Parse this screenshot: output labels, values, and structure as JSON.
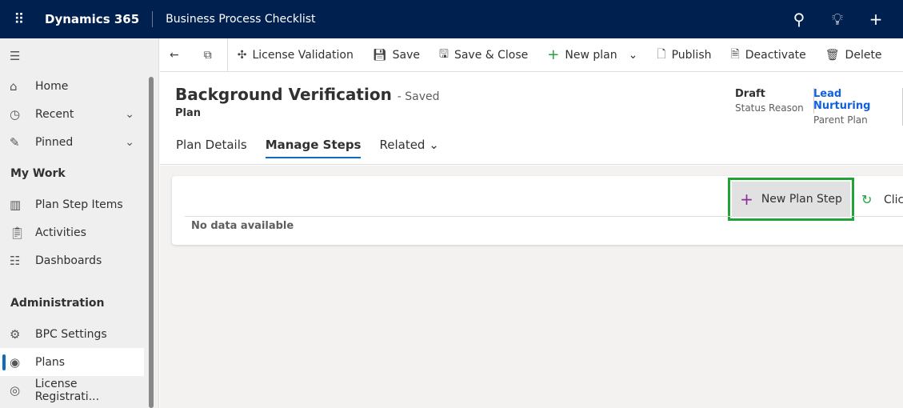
{
  "topbar": {
    "brand": "Dynamics 365",
    "app": "Business Process Checklist",
    "icons": [
      "waffle-icon",
      "search-icon",
      "lightbulb-icon",
      "plus-icon"
    ]
  },
  "sidebar": {
    "items": [
      {
        "label": "Home",
        "icon": "home-icon"
      },
      {
        "label": "Recent",
        "icon": "clock-icon"
      },
      {
        "label": "Pinned",
        "icon": "pin-icon"
      }
    ],
    "my_work": {
      "label": "My Work",
      "items": [
        {
          "label": "Plan Step Items"
        },
        {
          "label": "Activities"
        },
        {
          "label": "Dashboards"
        }
      ]
    },
    "admin": {
      "label": "Administration",
      "items": [
        {
          "label": "BPC Settings"
        },
        {
          "label": "Plans",
          "selected": true
        },
        {
          "label": "License Registrati..."
        }
      ]
    }
  },
  "commandbar": {
    "license": "License Validation",
    "save": "Save",
    "save_close": "Save & Close",
    "new_plan": "New plan",
    "publish": "Publish",
    "deactivate": "Deactivate",
    "delete": "Delete"
  },
  "header": {
    "title": "Background Verification",
    "saved": "- Saved",
    "entity": "Plan",
    "fields": [
      {
        "value": "Draft",
        "label": "Status Reason"
      },
      {
        "value": "Lead Nurturing",
        "label": "Parent Plan"
      }
    ]
  },
  "tabs": [
    {
      "label": "Plan Details"
    },
    {
      "label": "Manage Steps",
      "active": true
    },
    {
      "label": "Related"
    }
  ],
  "grid": {
    "new_step": "New Plan Step",
    "refresh_label": "Clic",
    "empty": "No data available"
  },
  "colors": {
    "topbar": "#002050",
    "highlight": "#21a33a",
    "link": "#1160e0"
  }
}
